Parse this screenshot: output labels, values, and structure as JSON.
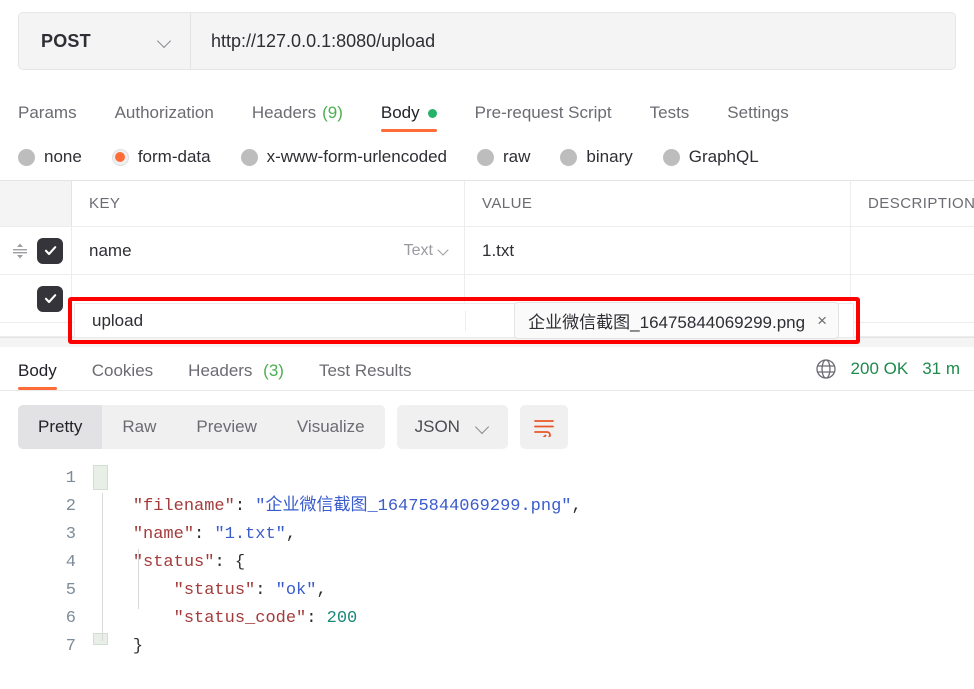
{
  "request": {
    "method": "POST",
    "url": "http://127.0.0.1:8080/upload",
    "tabs": [
      {
        "label": "Params",
        "count": "",
        "dot": false,
        "active": false
      },
      {
        "label": "Authorization",
        "count": "",
        "dot": false,
        "active": false
      },
      {
        "label": "Headers",
        "count": "(9)",
        "dot": false,
        "active": false
      },
      {
        "label": "Body",
        "count": "",
        "dot": true,
        "active": true
      },
      {
        "label": "Pre-request Script",
        "count": "",
        "dot": false,
        "active": false
      },
      {
        "label": "Tests",
        "count": "",
        "dot": false,
        "active": false
      },
      {
        "label": "Settings",
        "count": "",
        "dot": false,
        "active": false
      }
    ],
    "body_types": [
      {
        "label": "none",
        "checked": false
      },
      {
        "label": "form-data",
        "checked": true
      },
      {
        "label": "x-www-form-urlencoded",
        "checked": false
      },
      {
        "label": "raw",
        "checked": false
      },
      {
        "label": "binary",
        "checked": false
      },
      {
        "label": "GraphQL",
        "checked": false
      }
    ],
    "table": {
      "headers": {
        "key": "KEY",
        "value": "VALUE",
        "description": "DESCRIPTION"
      },
      "rows": [
        {
          "checked": true,
          "key": "name",
          "type": "Text",
          "value": "1.txt",
          "description": "",
          "is_file": false
        },
        {
          "checked": true,
          "key": "upload",
          "type": "",
          "value": "企业微信截图_16475844069299.png",
          "description": "",
          "is_file": true,
          "remove_label": "×"
        }
      ]
    }
  },
  "response": {
    "tabs": [
      {
        "label": "Body",
        "count": "",
        "active": true
      },
      {
        "label": "Cookies",
        "count": "",
        "active": false
      },
      {
        "label": "Headers",
        "count": "(3)",
        "active": false
      },
      {
        "label": "Test Results",
        "count": "",
        "active": false
      }
    ],
    "status": "200 OK",
    "time": "31 m",
    "view_modes": [
      {
        "label": "Pretty",
        "active": true
      },
      {
        "label": "Raw",
        "active": false
      },
      {
        "label": "Preview",
        "active": false
      },
      {
        "label": "Visualize",
        "active": false
      }
    ],
    "format": "JSON",
    "line_numbers": [
      "1",
      "2",
      "3",
      "4",
      "5",
      "6",
      "7"
    ],
    "code_lines": [
      [
        {
          "t": "{",
          "c": "p"
        }
      ],
      [
        {
          "t": "    ",
          "c": "p"
        },
        {
          "t": "\"filename\"",
          "c": "k"
        },
        {
          "t": ": ",
          "c": "p"
        },
        {
          "t": "\"企业微信截图_16475844069299.png\"",
          "c": "s"
        },
        {
          "t": ",",
          "c": "p"
        }
      ],
      [
        {
          "t": "    ",
          "c": "p"
        },
        {
          "t": "\"name\"",
          "c": "k"
        },
        {
          "t": ": ",
          "c": "p"
        },
        {
          "t": "\"1.txt\"",
          "c": "s"
        },
        {
          "t": ",",
          "c": "p"
        }
      ],
      [
        {
          "t": "    ",
          "c": "p"
        },
        {
          "t": "\"status\"",
          "c": "k"
        },
        {
          "t": ": ",
          "c": "p"
        },
        {
          "t": "{",
          "c": "p"
        }
      ],
      [
        {
          "t": "        ",
          "c": "p"
        },
        {
          "t": "\"status\"",
          "c": "k"
        },
        {
          "t": ": ",
          "c": "p"
        },
        {
          "t": "\"ok\"",
          "c": "s"
        },
        {
          "t": ",",
          "c": "p"
        }
      ],
      [
        {
          "t": "        ",
          "c": "p"
        },
        {
          "t": "\"status_code\"",
          "c": "k"
        },
        {
          "t": ": ",
          "c": "p"
        },
        {
          "t": "200",
          "c": "n"
        }
      ],
      [
        {
          "t": "    ",
          "c": "p"
        },
        {
          "t": "}",
          "c": "p"
        }
      ]
    ]
  },
  "colors": {
    "accent": "#ff6c37",
    "success": "#1e8a4c",
    "highlight_box": "#ff0000",
    "dot_green": "#26b26b"
  }
}
